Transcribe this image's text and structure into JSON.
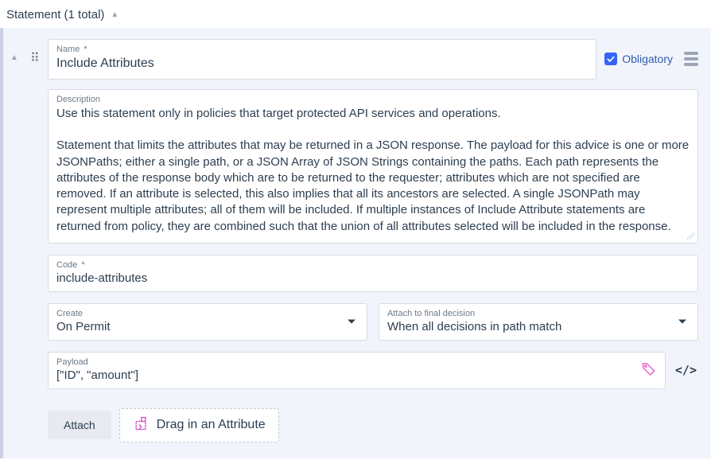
{
  "section": {
    "title": "Statement (1 total)"
  },
  "statement": {
    "name_label": "Name",
    "name_value": "Include Attributes",
    "obligatory_label": "Obligatory",
    "obligatory_checked": true,
    "description_label": "Description",
    "description_value": "Use this statement only in policies that target protected API services and operations.\n\nStatement that limits the attributes that may be returned in a JSON response. The payload for this advice is one or more JSONPaths; either a single path, or a JSON Array of JSON Strings containing the paths. Each path represents the attributes of the response body which are to be returned to the requester; attributes which are not specified are removed. If an attribute is selected, this also implies that all its ancestors are selected. A single JSONPath may represent multiple attributes; all of them will be included. If multiple instances of Include Attribute statements are returned from policy, they are combined such that the union of all attributes selected will be included in the response.",
    "code_label": "Code",
    "code_value": "include-attributes",
    "create_label": "Create",
    "create_value": "On Permit",
    "attach_final_label": "Attach to final decision",
    "attach_final_value": "When all decisions in path match",
    "payload_label": "Payload",
    "payload_value": "[\"ID\", \"amount\"]",
    "attach_button": "Attach",
    "dropzone_text": "Drag in an Attribute"
  }
}
